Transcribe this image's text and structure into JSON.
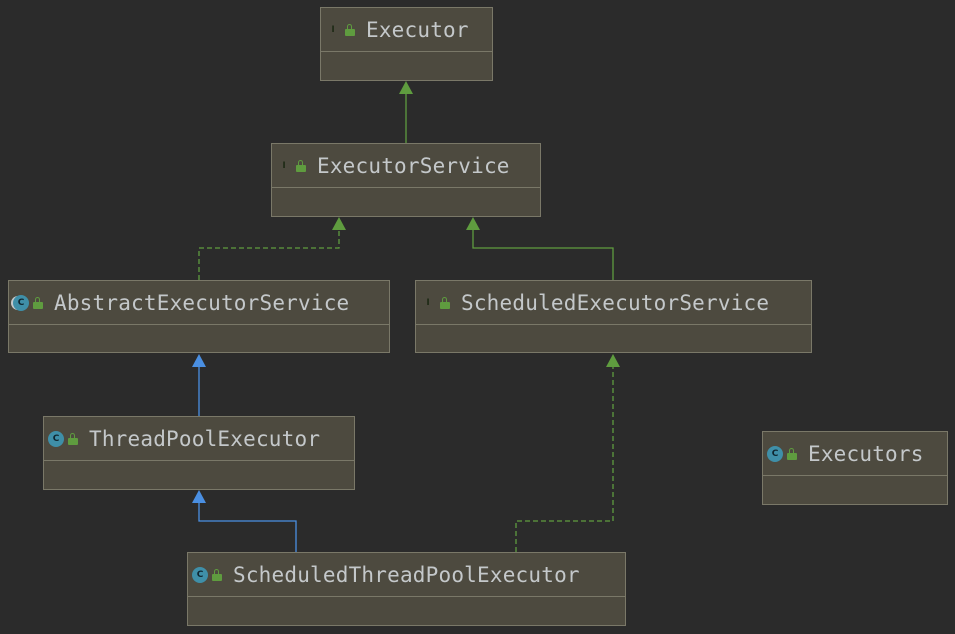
{
  "diagram": {
    "nodes": [
      {
        "id": "executor",
        "label": "Executor",
        "kind": "interface",
        "kind_letter": "I",
        "icon": "interface-icon"
      },
      {
        "id": "executor_service",
        "label": "ExecutorService",
        "kind": "interface",
        "kind_letter": "I",
        "icon": "interface-icon"
      },
      {
        "id": "abstract_executor_service",
        "label": "AbstractExecutorService",
        "kind": "abstract",
        "kind_letter": "C",
        "icon": "abstract-class-icon"
      },
      {
        "id": "scheduled_executor_service",
        "label": "ScheduledExecutorService",
        "kind": "interface",
        "kind_letter": "I",
        "icon": "interface-icon"
      },
      {
        "id": "thread_pool_executor",
        "label": "ThreadPoolExecutor",
        "kind": "class",
        "kind_letter": "C",
        "icon": "class-icon"
      },
      {
        "id": "executors",
        "label": "Executors",
        "kind": "class",
        "kind_letter": "C",
        "icon": "class-icon"
      },
      {
        "id": "scheduled_thread_pool_executor",
        "label": "ScheduledThreadPoolExecutor",
        "kind": "class",
        "kind_letter": "C",
        "icon": "class-icon"
      }
    ],
    "edges": [
      {
        "from": "executor_service",
        "to": "executor",
        "type": "extends-interface",
        "style": "solid",
        "color": "#5f9c3f"
      },
      {
        "from": "abstract_executor_service",
        "to": "executor_service",
        "type": "implements",
        "style": "dashed",
        "color": "#5f9c3f"
      },
      {
        "from": "scheduled_executor_service",
        "to": "executor_service",
        "type": "extends-interface",
        "style": "solid",
        "color": "#5f9c3f"
      },
      {
        "from": "thread_pool_executor",
        "to": "abstract_executor_service",
        "type": "extends-class",
        "style": "solid",
        "color": "#4a8fe2"
      },
      {
        "from": "scheduled_thread_pool_executor",
        "to": "thread_pool_executor",
        "type": "extends-class",
        "style": "solid",
        "color": "#4a8fe2"
      },
      {
        "from": "scheduled_thread_pool_executor",
        "to": "scheduled_executor_service",
        "type": "implements",
        "style": "dashed",
        "color": "#5f9c3f"
      }
    ],
    "colors": {
      "background": "#2b2b2b",
      "node_fill": "#4d4a3f",
      "node_border": "#7a7868",
      "text": "#c4c8ca",
      "interface": "#62a63d",
      "class": "#3f8fa8",
      "realization": "#5f9c3f",
      "generalization": "#4a8fe2"
    }
  }
}
